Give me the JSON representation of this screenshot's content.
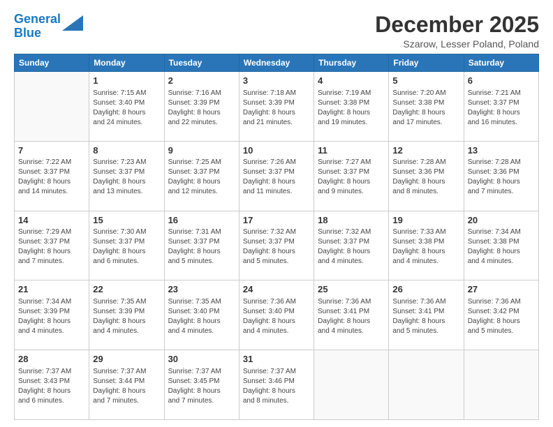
{
  "logo": {
    "line1": "General",
    "line2": "Blue"
  },
  "title": "December 2025",
  "subtitle": "Szarow, Lesser Poland, Poland",
  "header_days": [
    "Sunday",
    "Monday",
    "Tuesday",
    "Wednesday",
    "Thursday",
    "Friday",
    "Saturday"
  ],
  "weeks": [
    [
      {
        "day": "",
        "info": ""
      },
      {
        "day": "1",
        "info": "Sunrise: 7:15 AM\nSunset: 3:40 PM\nDaylight: 8 hours\nand 24 minutes."
      },
      {
        "day": "2",
        "info": "Sunrise: 7:16 AM\nSunset: 3:39 PM\nDaylight: 8 hours\nand 22 minutes."
      },
      {
        "day": "3",
        "info": "Sunrise: 7:18 AM\nSunset: 3:39 PM\nDaylight: 8 hours\nand 21 minutes."
      },
      {
        "day": "4",
        "info": "Sunrise: 7:19 AM\nSunset: 3:38 PM\nDaylight: 8 hours\nand 19 minutes."
      },
      {
        "day": "5",
        "info": "Sunrise: 7:20 AM\nSunset: 3:38 PM\nDaylight: 8 hours\nand 17 minutes."
      },
      {
        "day": "6",
        "info": "Sunrise: 7:21 AM\nSunset: 3:37 PM\nDaylight: 8 hours\nand 16 minutes."
      }
    ],
    [
      {
        "day": "7",
        "info": "Sunrise: 7:22 AM\nSunset: 3:37 PM\nDaylight: 8 hours\nand 14 minutes."
      },
      {
        "day": "8",
        "info": "Sunrise: 7:23 AM\nSunset: 3:37 PM\nDaylight: 8 hours\nand 13 minutes."
      },
      {
        "day": "9",
        "info": "Sunrise: 7:25 AM\nSunset: 3:37 PM\nDaylight: 8 hours\nand 12 minutes."
      },
      {
        "day": "10",
        "info": "Sunrise: 7:26 AM\nSunset: 3:37 PM\nDaylight: 8 hours\nand 11 minutes."
      },
      {
        "day": "11",
        "info": "Sunrise: 7:27 AM\nSunset: 3:37 PM\nDaylight: 8 hours\nand 9 minutes."
      },
      {
        "day": "12",
        "info": "Sunrise: 7:28 AM\nSunset: 3:36 PM\nDaylight: 8 hours\nand 8 minutes."
      },
      {
        "day": "13",
        "info": "Sunrise: 7:28 AM\nSunset: 3:36 PM\nDaylight: 8 hours\nand 7 minutes."
      }
    ],
    [
      {
        "day": "14",
        "info": "Sunrise: 7:29 AM\nSunset: 3:37 PM\nDaylight: 8 hours\nand 7 minutes."
      },
      {
        "day": "15",
        "info": "Sunrise: 7:30 AM\nSunset: 3:37 PM\nDaylight: 8 hours\nand 6 minutes."
      },
      {
        "day": "16",
        "info": "Sunrise: 7:31 AM\nSunset: 3:37 PM\nDaylight: 8 hours\nand 5 minutes."
      },
      {
        "day": "17",
        "info": "Sunrise: 7:32 AM\nSunset: 3:37 PM\nDaylight: 8 hours\nand 5 minutes."
      },
      {
        "day": "18",
        "info": "Sunrise: 7:32 AM\nSunset: 3:37 PM\nDaylight: 8 hours\nand 4 minutes."
      },
      {
        "day": "19",
        "info": "Sunrise: 7:33 AM\nSunset: 3:38 PM\nDaylight: 8 hours\nand 4 minutes."
      },
      {
        "day": "20",
        "info": "Sunrise: 7:34 AM\nSunset: 3:38 PM\nDaylight: 8 hours\nand 4 minutes."
      }
    ],
    [
      {
        "day": "21",
        "info": "Sunrise: 7:34 AM\nSunset: 3:39 PM\nDaylight: 8 hours\nand 4 minutes."
      },
      {
        "day": "22",
        "info": "Sunrise: 7:35 AM\nSunset: 3:39 PM\nDaylight: 8 hours\nand 4 minutes."
      },
      {
        "day": "23",
        "info": "Sunrise: 7:35 AM\nSunset: 3:40 PM\nDaylight: 8 hours\nand 4 minutes."
      },
      {
        "day": "24",
        "info": "Sunrise: 7:36 AM\nSunset: 3:40 PM\nDaylight: 8 hours\nand 4 minutes."
      },
      {
        "day": "25",
        "info": "Sunrise: 7:36 AM\nSunset: 3:41 PM\nDaylight: 8 hours\nand 4 minutes."
      },
      {
        "day": "26",
        "info": "Sunrise: 7:36 AM\nSunset: 3:41 PM\nDaylight: 8 hours\nand 5 minutes."
      },
      {
        "day": "27",
        "info": "Sunrise: 7:36 AM\nSunset: 3:42 PM\nDaylight: 8 hours\nand 5 minutes."
      }
    ],
    [
      {
        "day": "28",
        "info": "Sunrise: 7:37 AM\nSunset: 3:43 PM\nDaylight: 8 hours\nand 6 minutes."
      },
      {
        "day": "29",
        "info": "Sunrise: 7:37 AM\nSunset: 3:44 PM\nDaylight: 8 hours\nand 7 minutes."
      },
      {
        "day": "30",
        "info": "Sunrise: 7:37 AM\nSunset: 3:45 PM\nDaylight: 8 hours\nand 7 minutes."
      },
      {
        "day": "31",
        "info": "Sunrise: 7:37 AM\nSunset: 3:46 PM\nDaylight: 8 hours\nand 8 minutes."
      },
      {
        "day": "",
        "info": ""
      },
      {
        "day": "",
        "info": ""
      },
      {
        "day": "",
        "info": ""
      }
    ]
  ]
}
